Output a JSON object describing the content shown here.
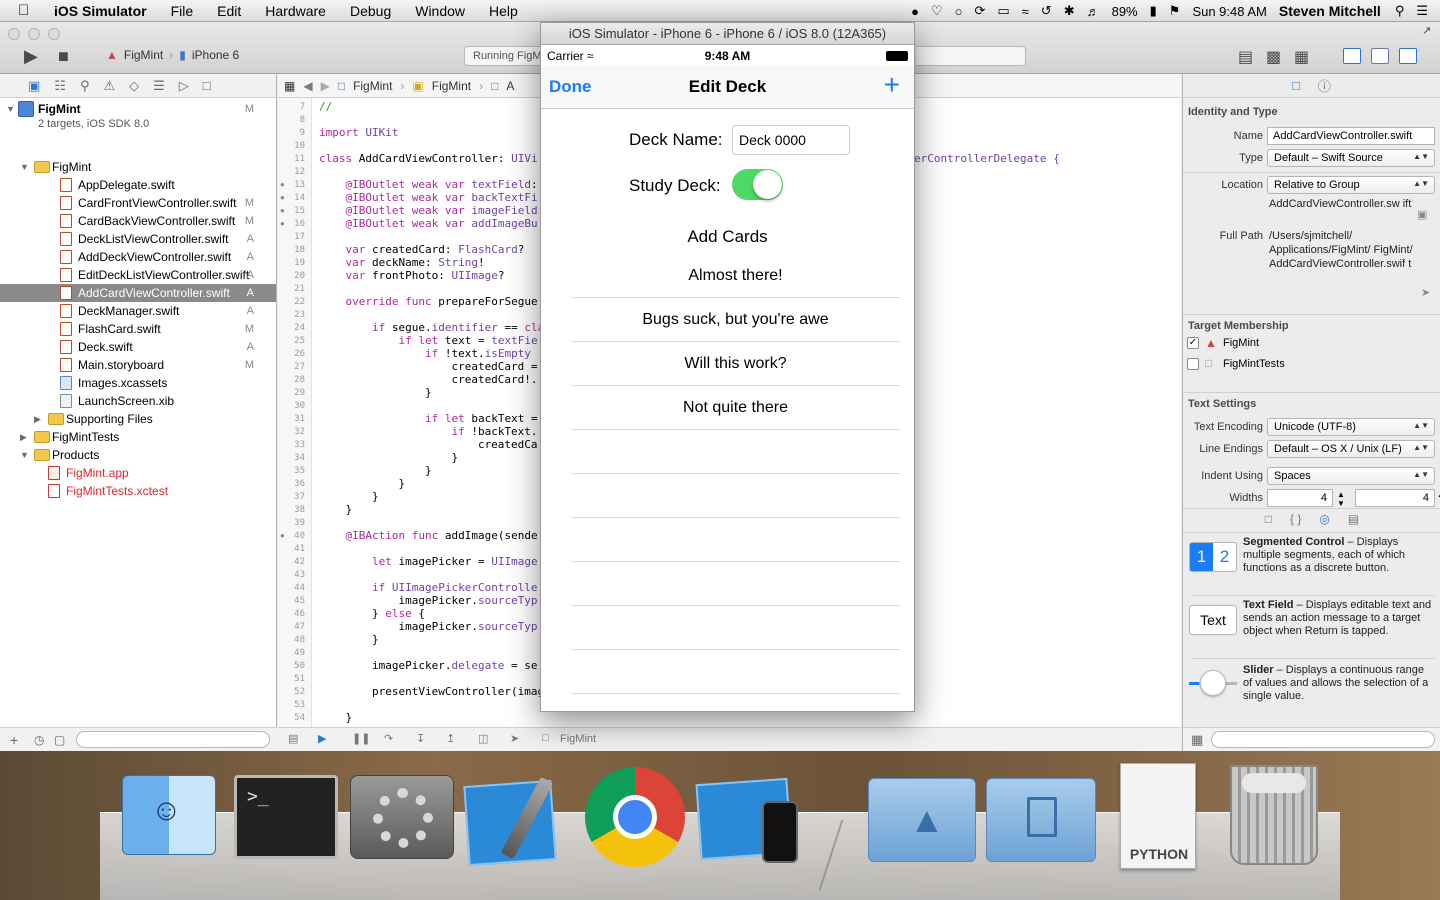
{
  "menubar": {
    "app": "iOS Simulator",
    "items": [
      "File",
      "Edit",
      "Hardware",
      "Debug",
      "Window",
      "Help"
    ],
    "battery": "89%",
    "clock": "Sun 9:48 AM",
    "user": "Steven Mitchell"
  },
  "toolbar": {
    "scheme": "FigMint",
    "device": "iPhone 6",
    "activity": "Running FigM"
  },
  "navigator": {
    "project": {
      "name": "FigMint",
      "subtitle": "2 targets, iOS SDK 8.0",
      "badge": "M"
    },
    "items": [
      {
        "name": "FigMint",
        "type": "folder",
        "badge": ""
      },
      {
        "name": "AppDelegate.swift",
        "type": "swift",
        "badge": ""
      },
      {
        "name": "CardFrontViewController.swift",
        "type": "swift",
        "badge": "M"
      },
      {
        "name": "CardBackViewController.swift",
        "type": "swift",
        "badge": "M"
      },
      {
        "name": "DeckListViewController.swift",
        "type": "swift",
        "badge": "A"
      },
      {
        "name": "AddDeckViewController.swift",
        "type": "swift",
        "badge": "A"
      },
      {
        "name": "EditDeckListViewController.swift",
        "type": "swift",
        "badge": "A"
      },
      {
        "name": "AddCardViewController.swift",
        "type": "swift",
        "badge": "A"
      },
      {
        "name": "DeckManager.swift",
        "type": "swift",
        "badge": "A"
      },
      {
        "name": "FlashCard.swift",
        "type": "swift",
        "badge": "M"
      },
      {
        "name": "Deck.swift",
        "type": "swift",
        "badge": "A"
      },
      {
        "name": "Main.storyboard",
        "type": "storyboard",
        "badge": "M"
      },
      {
        "name": "Images.xcassets",
        "type": "asset",
        "badge": ""
      },
      {
        "name": "LaunchScreen.xib",
        "type": "xib",
        "badge": ""
      },
      {
        "name": "Supporting Files",
        "type": "folder",
        "badge": ""
      },
      {
        "name": "FigMintTests",
        "type": "folder",
        "badge": ""
      },
      {
        "name": "Products",
        "type": "folder",
        "badge": ""
      },
      {
        "name": "FigMint.app",
        "type": "app",
        "badge": ""
      },
      {
        "name": "FigMintTests.xctest",
        "type": "xctest",
        "badge": ""
      }
    ]
  },
  "jumpbar": {
    "crumbs": [
      "FigMint",
      "FigMint",
      "A"
    ]
  },
  "editor": {
    "line_numbers": [
      "7",
      "8",
      "9",
      "10",
      "11",
      "12",
      "13",
      "14",
      "15",
      "16",
      "17",
      "18",
      "19",
      "20",
      "21",
      "22",
      "23",
      "24",
      "25",
      "26",
      "27",
      "28",
      "29",
      "30",
      "31",
      "32",
      "33",
      "34",
      "35",
      "36",
      "37",
      "38",
      "39",
      "40",
      "41",
      "42",
      "43",
      "44",
      "45",
      "46",
      "47",
      "48",
      "49",
      "50",
      "51",
      "52",
      "53",
      "54"
    ],
    "lines": [
      {
        "n": "7",
        "t": "//"
      },
      {
        "n": "9",
        "t": "import UIKit"
      },
      {
        "n": "11",
        "t": "class AddCardViewController: UIVi"
      },
      {
        "n": "13",
        "t": "    @IBOutlet weak var textField:"
      },
      {
        "n": "14",
        "t": "    @IBOutlet weak var backTextFi"
      },
      {
        "n": "15",
        "t": "    @IBOutlet weak var imageField"
      },
      {
        "n": "16",
        "t": "    @IBOutlet weak var addImageBu"
      },
      {
        "n": "18",
        "t": "    var createdCard: FlashCard?"
      },
      {
        "n": "19",
        "t": "    var deckName: String!"
      },
      {
        "n": "20",
        "t": "    var frontPhoto: UIImage?"
      },
      {
        "n": "22",
        "t": "    override func prepareForSegue"
      },
      {
        "n": "24",
        "t": "        if segue.identifier == \"De"
      },
      {
        "n": "25",
        "t": "            if let text = textFie"
      },
      {
        "n": "26",
        "t": "                if !text.isEmpty "
      },
      {
        "n": "27",
        "t": "                    createdCard ="
      },
      {
        "n": "28",
        "t": "                    createdCard!."
      },
      {
        "n": "29",
        "t": "                }"
      },
      {
        "n": "31",
        "t": "                if let backText ="
      },
      {
        "n": "32",
        "t": "                    if !backText."
      },
      {
        "n": "33",
        "t": "                        createdCa"
      },
      {
        "n": "34",
        "t": "                    }"
      },
      {
        "n": "35",
        "t": "                }"
      },
      {
        "n": "36",
        "t": "            }"
      },
      {
        "n": "37",
        "t": "        }"
      },
      {
        "n": "38",
        "t": "    }"
      },
      {
        "n": "40",
        "t": "    @IBAction func addImage(sende"
      },
      {
        "n": "42",
        "t": "        let imagePicker = UIImage"
      },
      {
        "n": "44",
        "t": "        if UIImagePickerControlle"
      },
      {
        "n": "45",
        "t": "            imagePicker.sourceTyp"
      },
      {
        "n": "46",
        "t": "        } else {"
      },
      {
        "n": "47",
        "t": "            imagePicker.sourceTyp"
      },
      {
        "n": "48",
        "t": "        }"
      },
      {
        "n": "50",
        "t": "        imagePicker.delegate = se"
      },
      {
        "n": "52",
        "t": "        presentViewController(imag"
      },
      {
        "n": "54",
        "t": "    }"
      }
    ],
    "right_fragment": "erControllerDelegate {",
    "bottom_label": "FigMint"
  },
  "inspector": {
    "identity_title": "Identity and Type",
    "name_label": "Name",
    "name_value": "AddCardViewController.swift",
    "type_label": "Type",
    "type_value": "Default – Swift Source",
    "location_label": "Location",
    "location_value": "Relative to Group",
    "location_path": "AddCardViewController.sw ift",
    "fullpath_label": "Full Path",
    "fullpath_value": "/Users/sjmitchell/ Applications/FigMint/ FigMint/ AddCardViewController.swif t",
    "target_title": "Target Membership",
    "targets": [
      {
        "name": "FigMint",
        "checked": true
      },
      {
        "name": "FigMintTests",
        "checked": false
      }
    ],
    "text_title": "Text Settings",
    "encoding_label": "Text Encoding",
    "encoding_value": "Unicode (UTF-8)",
    "endings_label": "Line Endings",
    "endings_value": "Default – OS X / Unix (LF)",
    "indent_label": "Indent Using",
    "indent_value": "Spaces",
    "widths_label": "Widths",
    "width_a": "4",
    "width_b": "4"
  },
  "library": [
    {
      "name": "Segmented Control",
      "desc": " – Displays multiple segments, each of which functions as a discrete button.",
      "icon_a": "1",
      "icon_b": "2"
    },
    {
      "name": "Text Field",
      "desc": " – Displays editable text and sends an action message to a target object when Return is tapped.",
      "icon": "Text"
    },
    {
      "name": "Slider",
      "desc": " – Displays a continuous range of values and allows the selection of a single value."
    }
  ],
  "simulator": {
    "title": "iOS Simulator - iPhone 6 - iPhone 6 / iOS 8.0 (12A365)",
    "carrier": "Carrier",
    "time": "9:48 AM",
    "nav_left": "Done",
    "nav_title": "Edit Deck",
    "nav_right": "+",
    "deck_name_label": "Deck Name:",
    "deck_name_value": "Deck 0000",
    "study_label": "Study Deck:",
    "study_on": true,
    "add_cards": "Add Cards",
    "cards": [
      "Almost there!",
      "Bugs suck, but you're awe",
      "Will this work?",
      "Not quite there",
      "",
      "",
      "",
      "",
      "",
      ""
    ]
  },
  "dock": {
    "items": [
      "Finder",
      "Terminal",
      "System Preferences",
      "Xcode",
      "Google Chrome",
      "iOS Simulator",
      "Applications",
      "Documents",
      "PYTHON",
      "Trash"
    ],
    "python_label": "PYTHON"
  }
}
